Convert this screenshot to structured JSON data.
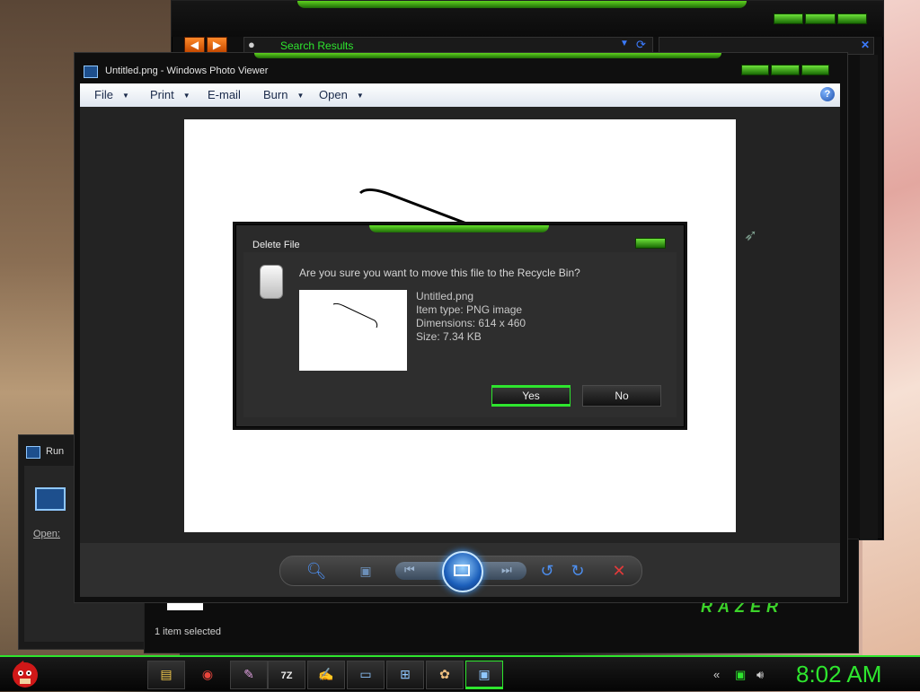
{
  "explorer": {
    "search_text": "Search Results",
    "status": "1 item selected",
    "brand": "RAZER"
  },
  "run": {
    "title": "Run",
    "open_label": "Open:"
  },
  "viewer": {
    "title": "Untitled.png - Windows Photo Viewer",
    "menu": [
      {
        "label": "File",
        "has_caret": true
      },
      {
        "label": "Print",
        "has_caret": true
      },
      {
        "label": "E-mail",
        "has_caret": false
      },
      {
        "label": "Burn",
        "has_caret": true
      },
      {
        "label": "Open",
        "has_caret": true
      }
    ],
    "help": "?"
  },
  "dialog": {
    "title": "Delete File",
    "question": "Are you sure you want to move this file to the Recycle Bin?",
    "file_name": "Untitled.png",
    "item_type": "Item type: PNG image",
    "dimensions": "Dimensions: 614 x 460",
    "size": "Size: 7.34 KB",
    "yes_label": "Yes",
    "no_label": "No"
  },
  "taskbar": {
    "clock": "8:02 AM",
    "items": [
      "folder",
      "chrome",
      "media",
      "7z",
      "notepad",
      "run",
      "network",
      "paint",
      "photo-viewer"
    ],
    "active_item": "photo-viewer"
  },
  "colors": {
    "accent": "#2ee52e",
    "dialog_bg": "#2a2a2a"
  }
}
